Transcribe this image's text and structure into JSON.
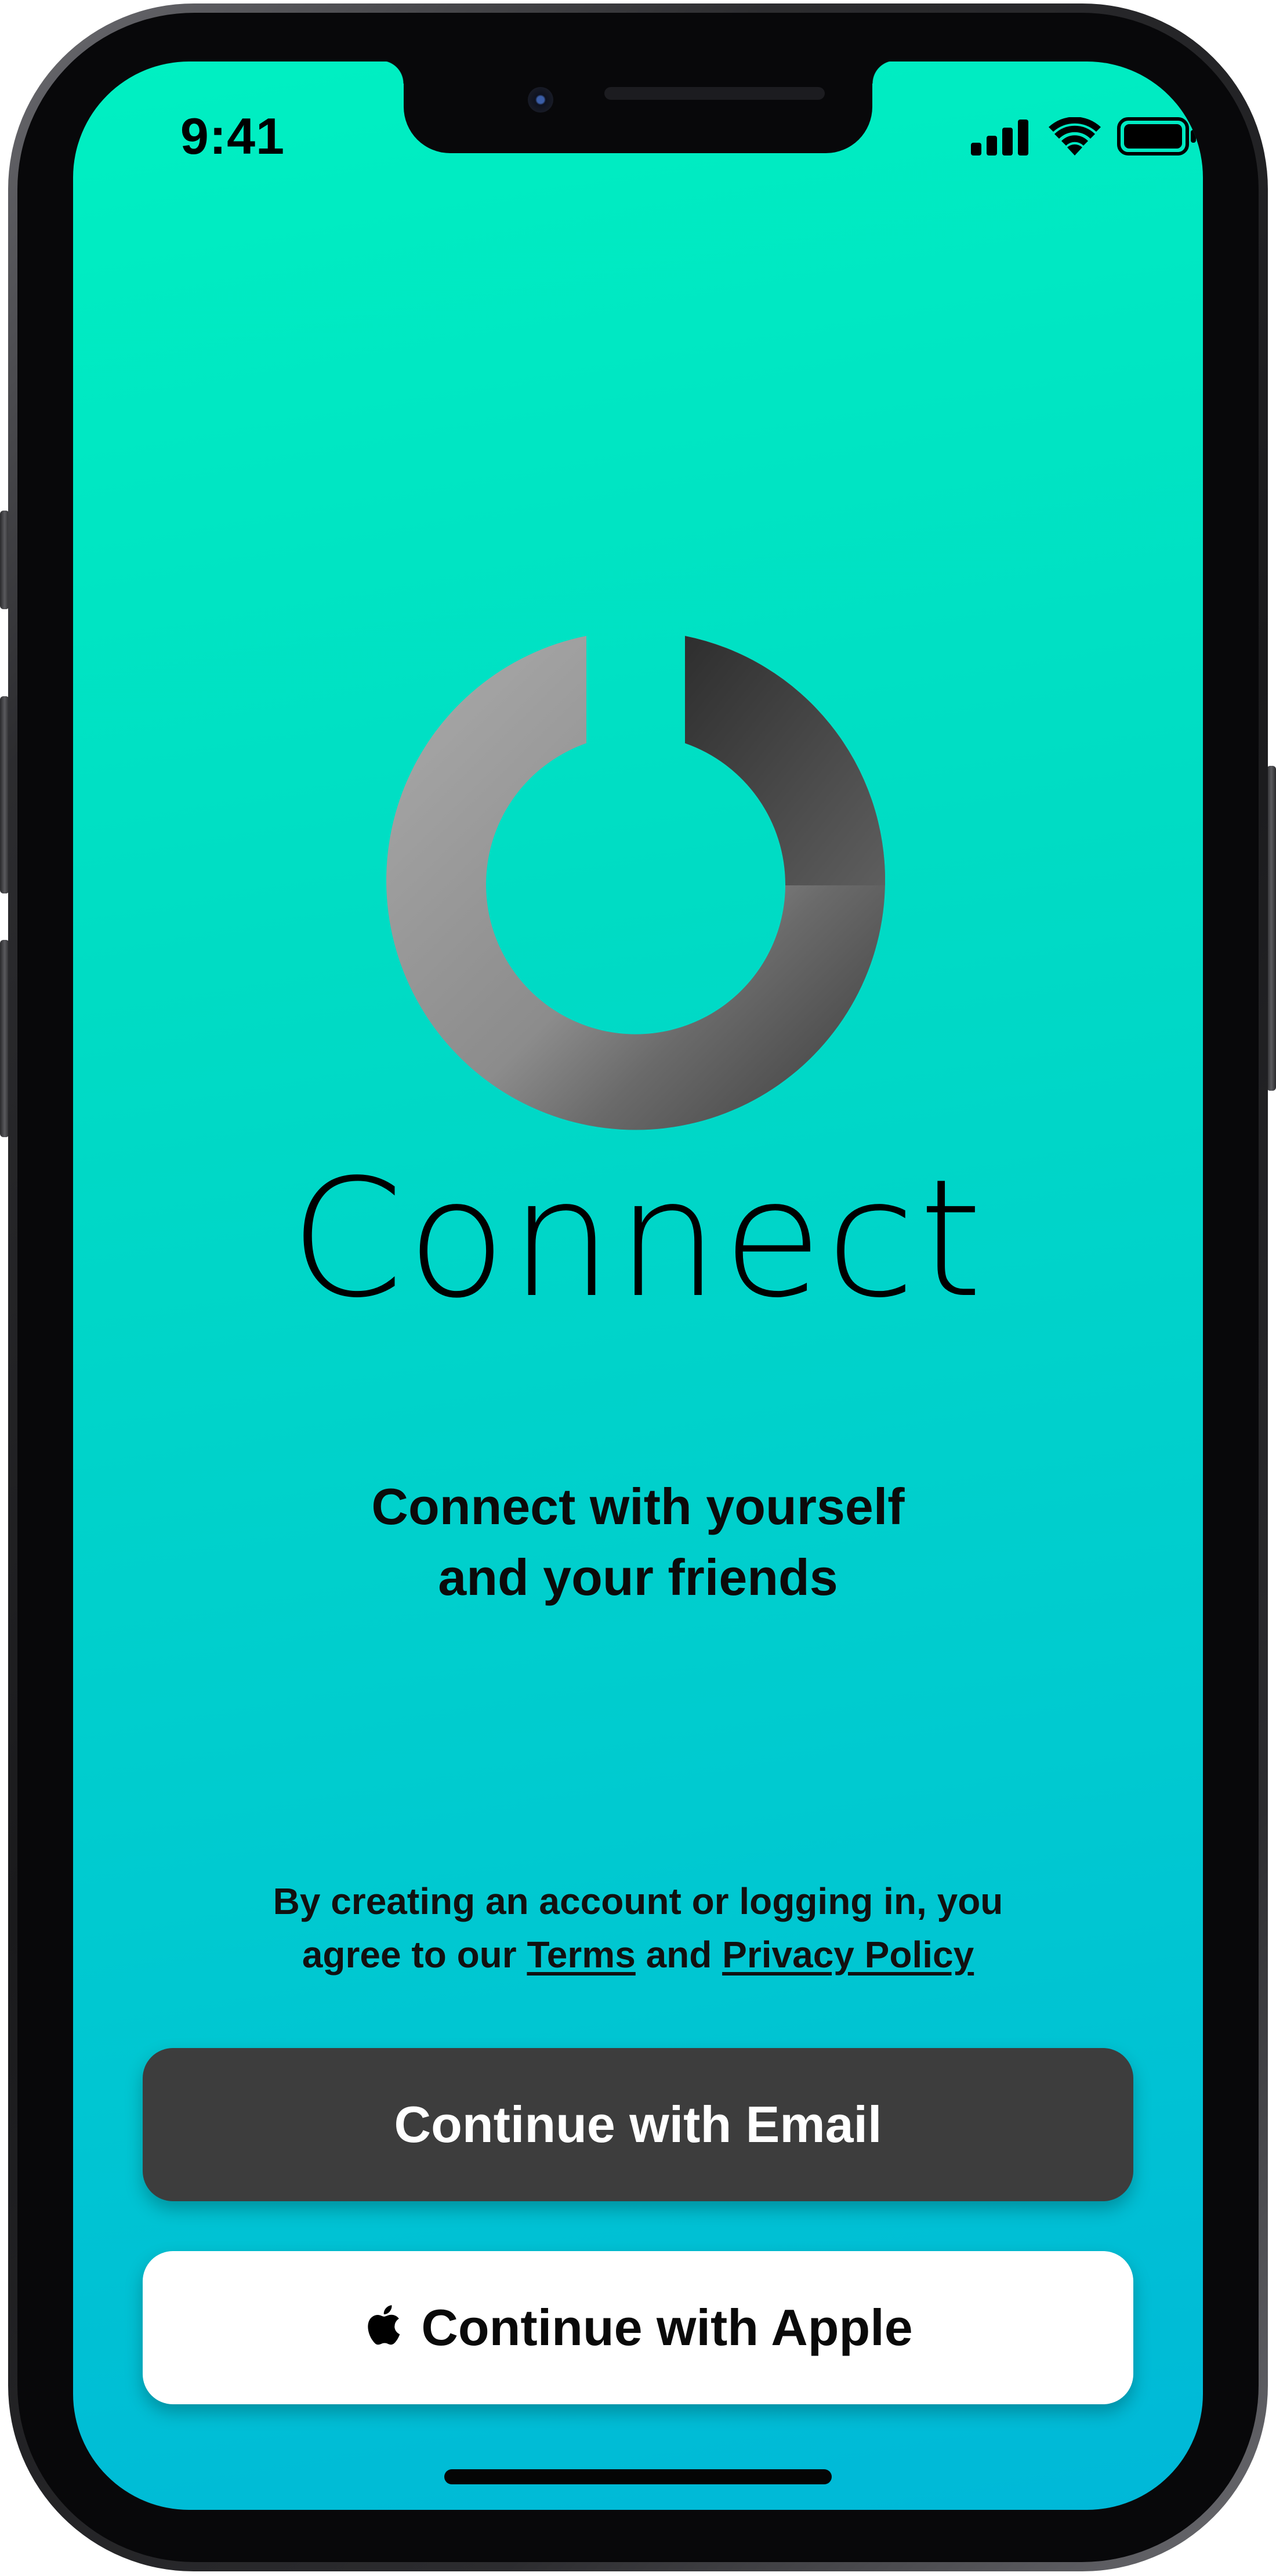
{
  "status_bar": {
    "time": "9:41",
    "icons": [
      "cellular-signal-icon",
      "wifi-icon",
      "battery-icon"
    ]
  },
  "app": {
    "logo": "power-ring-logo",
    "title": "Connect",
    "tagline_line1": "Connect with yourself",
    "tagline_line2": "and your friends"
  },
  "legal": {
    "line1": "By creating an account or logging in, you",
    "line2_prefix": "agree to our ",
    "terms_link": "Terms",
    "conjunction": " and ",
    "privacy_link": "Privacy Policy"
  },
  "buttons": {
    "email_label": "Continue with Email",
    "apple_label": "Continue with Apple"
  },
  "colors": {
    "background_top": "#00f0c2",
    "background_bottom": "#00b8d8",
    "email_button": "#3d3d3d",
    "apple_button": "#ffffff",
    "text": "#000000"
  }
}
